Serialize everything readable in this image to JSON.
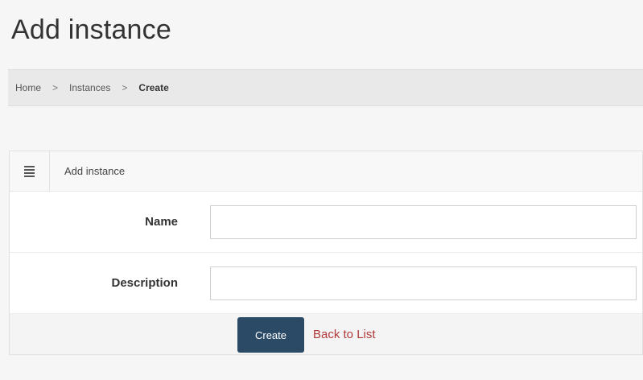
{
  "page": {
    "title": "Add instance"
  },
  "breadcrumb": {
    "items": [
      "Home",
      "Instances",
      "Create"
    ],
    "separator": ">"
  },
  "panel": {
    "title": "Add instance",
    "icon": "menu-icon"
  },
  "form": {
    "fields": [
      {
        "label": "Name",
        "value": "",
        "placeholder": ""
      },
      {
        "label": "Description",
        "value": "",
        "placeholder": ""
      }
    ],
    "submit_label": "Create",
    "back_label": "Back to List"
  },
  "colors": {
    "primary_button": "#2b4a66",
    "link": "#b03a3a",
    "background": "#f6f6f6"
  }
}
